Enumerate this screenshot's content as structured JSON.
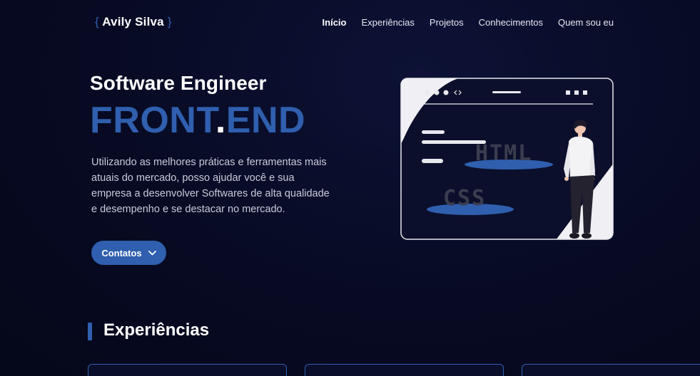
{
  "header": {
    "logo_open": "{",
    "logo_name": "Avily Silva",
    "logo_close": "}",
    "nav": [
      {
        "label": "Início",
        "active": true
      },
      {
        "label": "Experiências"
      },
      {
        "label": "Projetos"
      },
      {
        "label": "Conhecimentos"
      },
      {
        "label": "Quem sou eu"
      }
    ]
  },
  "hero": {
    "subtitle": "Software Engineer",
    "title_part1": "FRONT",
    "title_dot": ".",
    "title_part2": "END",
    "description": "Utilizando as melhores práticas e ferramentas mais atuais do mercado, posso ajudar você e sua empresa a desenvolver Softwares de alta qualidade e desempenho e se destacar no mercado.",
    "contact_button": "Contatos",
    "illustration": {
      "label_html": "HTML",
      "label_css": "CSS"
    }
  },
  "experiences": {
    "title": "Experiências"
  },
  "colors": {
    "accent": "#2f5fae",
    "background": "#070a22",
    "text": "#ffffff"
  }
}
